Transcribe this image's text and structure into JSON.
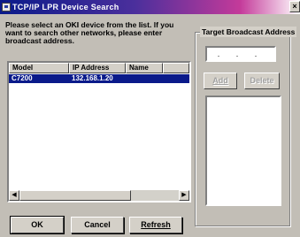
{
  "window": {
    "title": "TCP/IP LPR Device Search",
    "close_glyph": "×"
  },
  "instructions": "Please select an OKI device from the list. If you want to search other networks, please enter broadcast address.",
  "device_list": {
    "columns": [
      "Model",
      "IP Address",
      "Name"
    ],
    "rows": [
      {
        "model": "C7200",
        "ip": "132.168.1.20",
        "name": "",
        "selected": true
      }
    ]
  },
  "scrollbar": {
    "left_arrow": "◀",
    "right_arrow": "▶"
  },
  "buttons": {
    "ok": "OK",
    "cancel": "Cancel",
    "refresh": "Refresh",
    "add": "Add",
    "delete": "Delete"
  },
  "target_broadcast": {
    "label": "Target Broadcast Address",
    "value": ". . ."
  },
  "colors": {
    "selection": "#0a1a8a",
    "face": "#d4d0c8"
  }
}
